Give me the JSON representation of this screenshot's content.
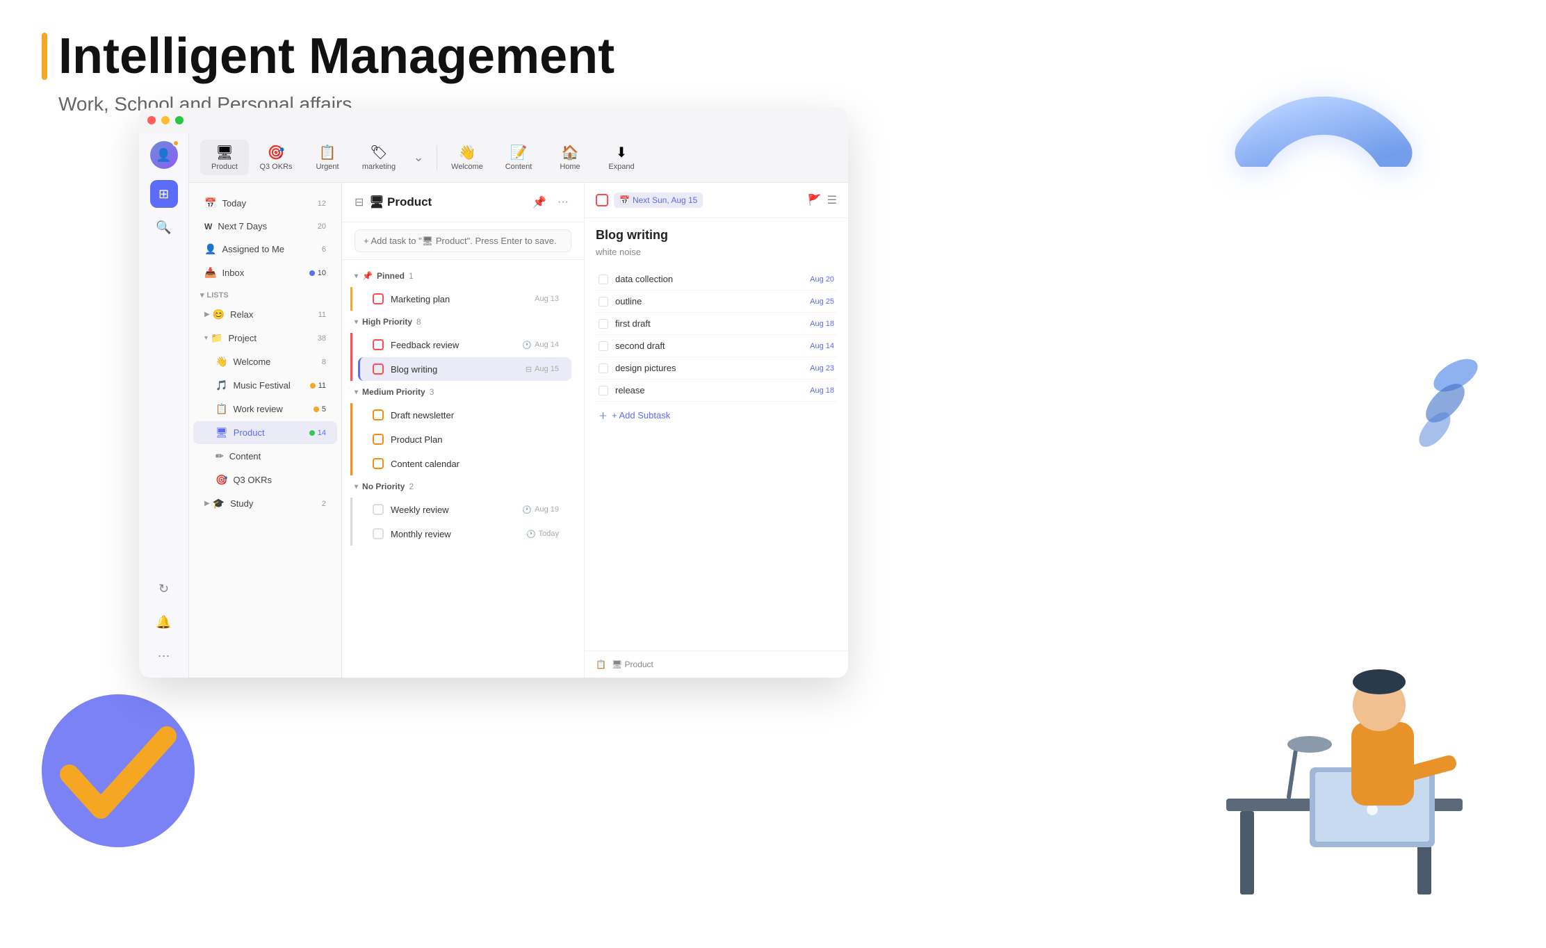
{
  "hero": {
    "title": "Intelligent Management",
    "subtitle": "Work, School and Personal affairs",
    "accent_color": "#f5a623"
  },
  "titlebar": {
    "lights": [
      "red",
      "yellow",
      "green"
    ]
  },
  "toolbar": {
    "items": [
      {
        "icon": "🖥",
        "label": "Product",
        "active": true
      },
      {
        "icon": "🎯",
        "label": "Q3 OKRs",
        "active": false
      },
      {
        "icon": "📋",
        "label": "Urgent",
        "active": false
      },
      {
        "icon": "🏷",
        "label": "marketing",
        "active": false
      }
    ],
    "items2": [
      {
        "icon": "👋",
        "label": "Welcome",
        "active": false
      },
      {
        "icon": "📝",
        "label": "Content",
        "active": false
      },
      {
        "icon": "🏠",
        "label": "🏠 Home",
        "active": false
      },
      {
        "icon": "⬇",
        "label": "Expand",
        "active": false
      }
    ]
  },
  "sidebar": {
    "icons": [
      {
        "name": "avatar",
        "icon": "👤",
        "badge": true
      },
      {
        "name": "home",
        "icon": "⊞",
        "active": true
      },
      {
        "name": "search",
        "icon": "🔍",
        "active": false
      },
      {
        "name": "sync",
        "icon": "↻",
        "active": false
      },
      {
        "name": "bell",
        "icon": "🔔",
        "active": false
      },
      {
        "name": "more",
        "icon": "···",
        "active": false
      }
    ]
  },
  "leftnav": {
    "items": [
      {
        "icon": "📅",
        "label": "Today",
        "count": "12"
      },
      {
        "icon": "W",
        "label": "Next 7 Days",
        "count": "20"
      },
      {
        "icon": "👤",
        "label": "Assigned to Me",
        "count": "6"
      },
      {
        "icon": "📥",
        "label": "Inbox",
        "dot_color": "blue",
        "count": "10"
      }
    ],
    "section_label": "Lists",
    "lists": [
      {
        "icon": "😊",
        "label": "Relax",
        "count": "11",
        "expanded": false
      },
      {
        "icon": "📁",
        "label": "Project",
        "count": "38",
        "expanded": true,
        "children": [
          {
            "icon": "👋",
            "label": "Welcome",
            "count": "8"
          },
          {
            "icon": "🎵",
            "label": "Music Festival",
            "dot_color": "orange",
            "count": "11"
          },
          {
            "icon": "📋",
            "label": "Work review",
            "dot_color": "orange",
            "count": "5"
          },
          {
            "icon": "🖥",
            "label": "Product",
            "dot_color": "green",
            "count": "14",
            "active": true
          },
          {
            "icon": "✏",
            "label": "Content",
            "count": ""
          },
          {
            "icon": "🎯",
            "label": "Q3 OKRs",
            "count": ""
          }
        ]
      },
      {
        "icon": "🎓",
        "label": "Study",
        "count": "2",
        "expanded": false
      }
    ]
  },
  "task_panel": {
    "title": "Product",
    "title_icon": "🖥",
    "add_placeholder": "+ Add task to \"🖥 Product\". Press Enter to save.",
    "groups": [
      {
        "name": "Pinned",
        "icon": "📌",
        "count": 1,
        "priority_color": "#f5a623",
        "tasks": [
          {
            "name": "Marketing plan",
            "date": "Aug 13",
            "checkbox_style": "red-border",
            "overdue": false
          }
        ]
      },
      {
        "name": "High Priority",
        "icon": "",
        "count": 8,
        "priority_color": "#ff4d4f",
        "tasks": [
          {
            "name": "Feedback review",
            "date": "Aug 14",
            "checkbox_style": "red-border",
            "clock": true
          },
          {
            "name": "Blog writing",
            "date": "Aug 15",
            "checkbox_style": "red-border",
            "selected": true,
            "has_icon": true
          }
        ]
      },
      {
        "name": "Medium Priority",
        "icon": "",
        "count": 3,
        "priority_color": "#fa8c16",
        "tasks": [
          {
            "name": "Draft newsletter",
            "date": "",
            "checkbox_style": "orange-border"
          },
          {
            "name": "Product Plan",
            "date": "",
            "checkbox_style": "orange-border"
          },
          {
            "name": "Content calendar",
            "date": "",
            "checkbox_style": "orange-border"
          }
        ]
      },
      {
        "name": "No Priority",
        "icon": "",
        "count": 2,
        "priority_color": "#d9d9d9",
        "tasks": [
          {
            "name": "Weekly review",
            "date": "Aug 19",
            "clock": true
          },
          {
            "name": "Monthly review",
            "date": "Today",
            "clock": true
          }
        ]
      }
    ]
  },
  "detail_panel": {
    "due_label": "Next Sun, Aug 15",
    "title": "Blog writing",
    "subtitle": "white noise",
    "subtasks": [
      {
        "name": "data collection",
        "date": "Aug 20"
      },
      {
        "name": "outline",
        "date": "Aug 25"
      },
      {
        "name": "first draft",
        "date": "Aug 18"
      },
      {
        "name": "second draft",
        "date": "Aug 14"
      },
      {
        "name": "design pictures",
        "date": "Aug 23"
      },
      {
        "name": "release",
        "date": "Aug 18"
      }
    ],
    "add_subtask_label": "+ Add Subtask",
    "footer_list": "🖥 Product"
  }
}
